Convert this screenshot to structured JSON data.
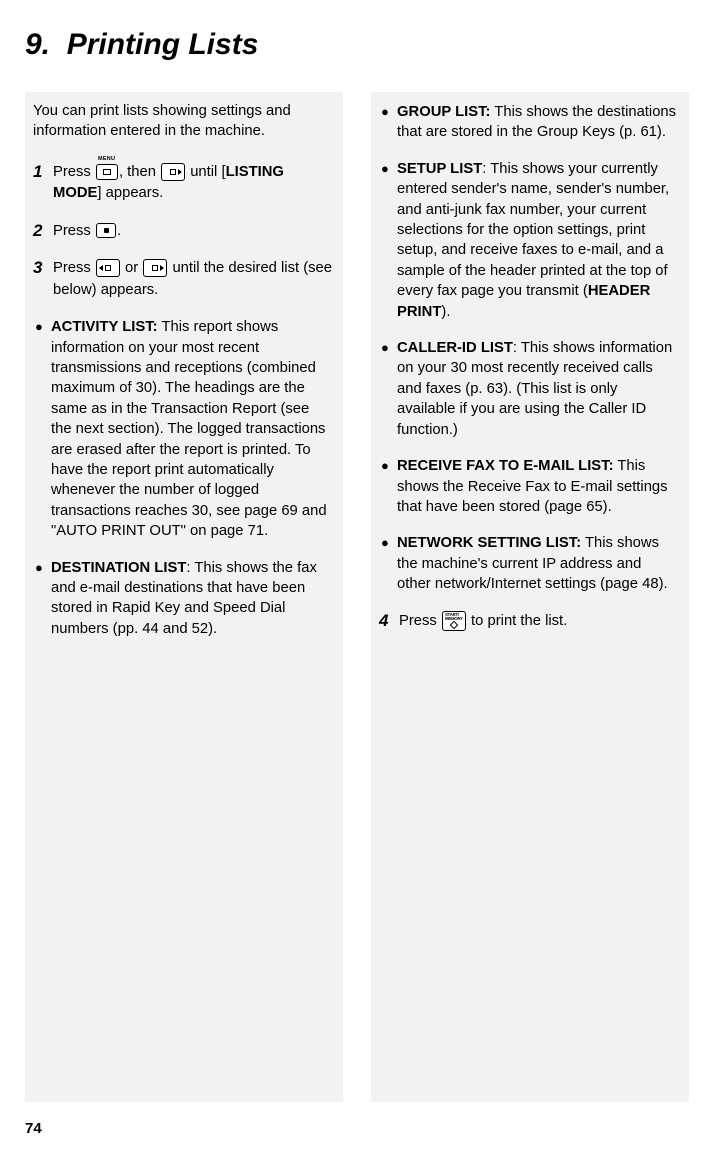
{
  "chapter": {
    "number": "9.",
    "title": "Printing Lists"
  },
  "intro": "You can print lists showing settings and information entered in the machine.",
  "steps": {
    "s1": {
      "num": "1",
      "p1": "Press ",
      "p2": ", then ",
      "p3": " until [",
      "bold": "LISTING MODE",
      "p4": "] appears."
    },
    "s2": {
      "num": "2",
      "p1": "Press ",
      "p2": "."
    },
    "s3": {
      "num": "3",
      "p1": "Press ",
      "p2": " or ",
      "p3": " until the desired list (see below) appears."
    },
    "s4": {
      "num": "4",
      "p1": "Press ",
      "p2": " to print the list."
    }
  },
  "bullets": {
    "activity": {
      "title": "ACTIVITY LIST:",
      "text": " This report shows information on your most recent transmissions and receptions (combined maximum of 30). The headings are the same as in the Transaction Report (see the next section). The logged transactions are erased after the report is printed. To have the report print automatically whenever the number of logged transactions reaches 30, see page 69 and \"AUTO PRINT OUT\" on page 71."
    },
    "dest": {
      "title": " DESTINATION LIST",
      "text": ": This shows the fax and e-mail destinations that have been stored in Rapid Key and Speed Dial numbers (pp. 44 and 52)."
    },
    "group": {
      "title": "GROUP LIST:",
      "text": " This shows the destinations that are stored in the Group Keys (p. 61)."
    },
    "setup": {
      "title": "SETUP LIST",
      "text1": ": This shows your currently entered sender's name, sender's number, and anti-junk fax number, your current selections for the option settings, print setup, and receive faxes to e-mail, and a sample of the header printed at the top of every fax page you transmit (",
      "bold": "HEADER PRINT",
      "text2": ")."
    },
    "caller": {
      "title": "CALLER-ID LIST",
      "text": ": This shows information on your 30 most recently received calls and faxes (p. 63). (This list is only available if you are using the Caller ID function.)"
    },
    "recvfax": {
      "title": "RECEIVE FAX TO E-MAIL LIST:",
      "text": " This shows the Receive Fax to E-mail settings that have been stored (page 65)."
    },
    "network": {
      "title": "NETWORK SETTING LIST:",
      "text": " This shows the machine's current IP address and other network/Internet settings (page 48)."
    }
  },
  "pageNumber": "74",
  "icons": {
    "menu": "MENU",
    "start": "START/\nMEMORY"
  }
}
